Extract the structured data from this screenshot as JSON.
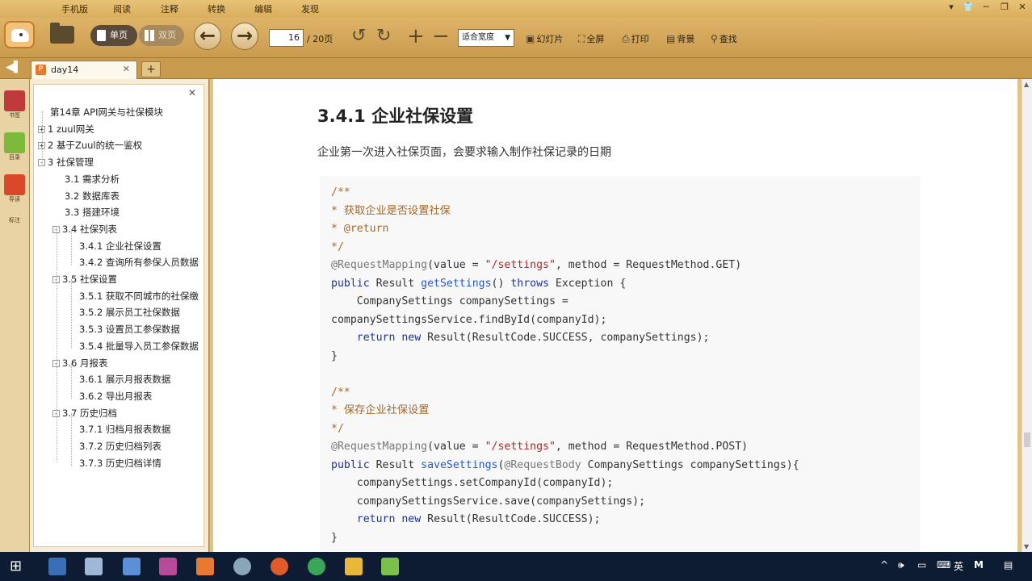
{
  "menu": {
    "items": [
      "手机版",
      "阅读",
      "注释",
      "转换",
      "编辑",
      "发现"
    ]
  },
  "toolbar": {
    "single_page": "单页",
    "double_page": "双页",
    "page_current": "16",
    "page_total": "/ 20页",
    "zoom_value": "适合宽度",
    "slideshow": "幻灯片",
    "fullscreen": "全屏",
    "print": "打印",
    "background": "背景",
    "find": "查找"
  },
  "tab": {
    "title": "day14"
  },
  "rail": {
    "items": [
      "书签",
      "目录",
      "导读",
      "标注"
    ]
  },
  "toc": [
    {
      "text": "第14章 API网关与社保模块",
      "level": 0,
      "toggle": ""
    },
    {
      "text": "1 zuul网关",
      "level": 0,
      "toggle": "+"
    },
    {
      "text": "2 基于Zuul的统一鉴权",
      "level": 0,
      "toggle": "+"
    },
    {
      "text": "3 社保管理",
      "level": 0,
      "toggle": "-"
    },
    {
      "text": "3.1 需求分析",
      "level": 1,
      "toggle": ""
    },
    {
      "text": "3.2 数据库表",
      "level": 1,
      "toggle": ""
    },
    {
      "text": "3.3 搭建环境",
      "level": 1,
      "toggle": ""
    },
    {
      "text": "3.4 社保列表",
      "level": 1,
      "toggle": "-"
    },
    {
      "text": "3.4.1 企业社保设置",
      "level": 2,
      "toggle": ""
    },
    {
      "text": "3.4.2 查询所有参保人员数据",
      "level": 2,
      "toggle": ""
    },
    {
      "text": "3.5 社保设置",
      "level": 1,
      "toggle": "-"
    },
    {
      "text": "3.5.1 获取不同城市的社保缴",
      "level": 2,
      "toggle": ""
    },
    {
      "text": "3.5.2 展示员工社保数据",
      "level": 2,
      "toggle": ""
    },
    {
      "text": "3.5.3 设置员工参保数据",
      "level": 2,
      "toggle": ""
    },
    {
      "text": "3.5.4 批量导入员工参保数据",
      "level": 2,
      "toggle": ""
    },
    {
      "text": "3.6 月报表",
      "level": 1,
      "toggle": "-"
    },
    {
      "text": "3.6.1 展示月报表数据",
      "level": 2,
      "toggle": ""
    },
    {
      "text": "3.6.2 导出月报表",
      "level": 2,
      "toggle": ""
    },
    {
      "text": "3.7 历史归档",
      "level": 1,
      "toggle": "-"
    },
    {
      "text": "3.7.1 归档月报表数据",
      "level": 2,
      "toggle": ""
    },
    {
      "text": "3.7.2 历史归档列表",
      "level": 2,
      "toggle": ""
    },
    {
      "text": "3.7.3 历史归档详情",
      "level": 2,
      "toggle": ""
    }
  ],
  "document": {
    "heading": "3.4.1 企业社保设置",
    "intro": "企业第一次进入社保页面，会要求输入制作社保记录的日期",
    "code": [
      [
        {
          "t": "/**",
          "c": "cm"
        }
      ],
      [
        {
          "t": "* 获取企业是否设置社保",
          "c": "cm"
        }
      ],
      [
        {
          "t": "* @return",
          "c": "cm"
        }
      ],
      [
        {
          "t": "*/",
          "c": "cm"
        }
      ],
      [
        {
          "t": "@RequestMapping",
          "c": "an"
        },
        {
          "t": "(value = ",
          "c": ""
        },
        {
          "t": "\"/settings\"",
          "c": "st"
        },
        {
          "t": ", method = RequestMethod.GET)",
          "c": ""
        }
      ],
      [
        {
          "t": "public",
          "c": "kw"
        },
        {
          "t": " Result ",
          "c": ""
        },
        {
          "t": "getSettings",
          "c": "fn"
        },
        {
          "t": "() ",
          "c": ""
        },
        {
          "t": "throws",
          "c": "kw"
        },
        {
          "t": " Exception {",
          "c": ""
        }
      ],
      [
        {
          "t": "    CompanySettings companySettings =",
          "c": ""
        }
      ],
      [
        {
          "t": "companySettingsService.findById(companyId);",
          "c": ""
        }
      ],
      [
        {
          "t": "    ",
          "c": ""
        },
        {
          "t": "return",
          "c": "kw"
        },
        {
          "t": " ",
          "c": ""
        },
        {
          "t": "new",
          "c": "kw"
        },
        {
          "t": " Result(ResultCode.SUCCESS, companySettings);",
          "c": ""
        }
      ],
      [
        {
          "t": "}",
          "c": ""
        }
      ],
      [
        {
          "t": "",
          "c": ""
        }
      ],
      [
        {
          "t": "/**",
          "c": "cm"
        }
      ],
      [
        {
          "t": "* 保存企业社保设置",
          "c": "cm"
        }
      ],
      [
        {
          "t": "*/",
          "c": "cm"
        }
      ],
      [
        {
          "t": "@RequestMapping",
          "c": "an"
        },
        {
          "t": "(value = ",
          "c": ""
        },
        {
          "t": "\"/settings\"",
          "c": "st"
        },
        {
          "t": ", method = RequestMethod.POST)",
          "c": ""
        }
      ],
      [
        {
          "t": "public",
          "c": "kw"
        },
        {
          "t": " Result ",
          "c": ""
        },
        {
          "t": "saveSettings",
          "c": "fn"
        },
        {
          "t": "(",
          "c": ""
        },
        {
          "t": "@RequestBody",
          "c": "an"
        },
        {
          "t": " CompanySettings companySettings){",
          "c": ""
        }
      ],
      [
        {
          "t": "    companySettings.setCompanyId(companyId);",
          "c": ""
        }
      ],
      [
        {
          "t": "    companySettingsService.save(companySettings);",
          "c": ""
        }
      ],
      [
        {
          "t": "    ",
          "c": ""
        },
        {
          "t": "return",
          "c": "kw"
        },
        {
          "t": " ",
          "c": ""
        },
        {
          "t": "new",
          "c": "kw"
        },
        {
          "t": " Result(ResultCode.SUCCESS);",
          "c": ""
        }
      ],
      [
        {
          "t": "}",
          "c": ""
        }
      ]
    ]
  },
  "taskbar": {
    "ime": "英",
    "ime2": "M"
  }
}
